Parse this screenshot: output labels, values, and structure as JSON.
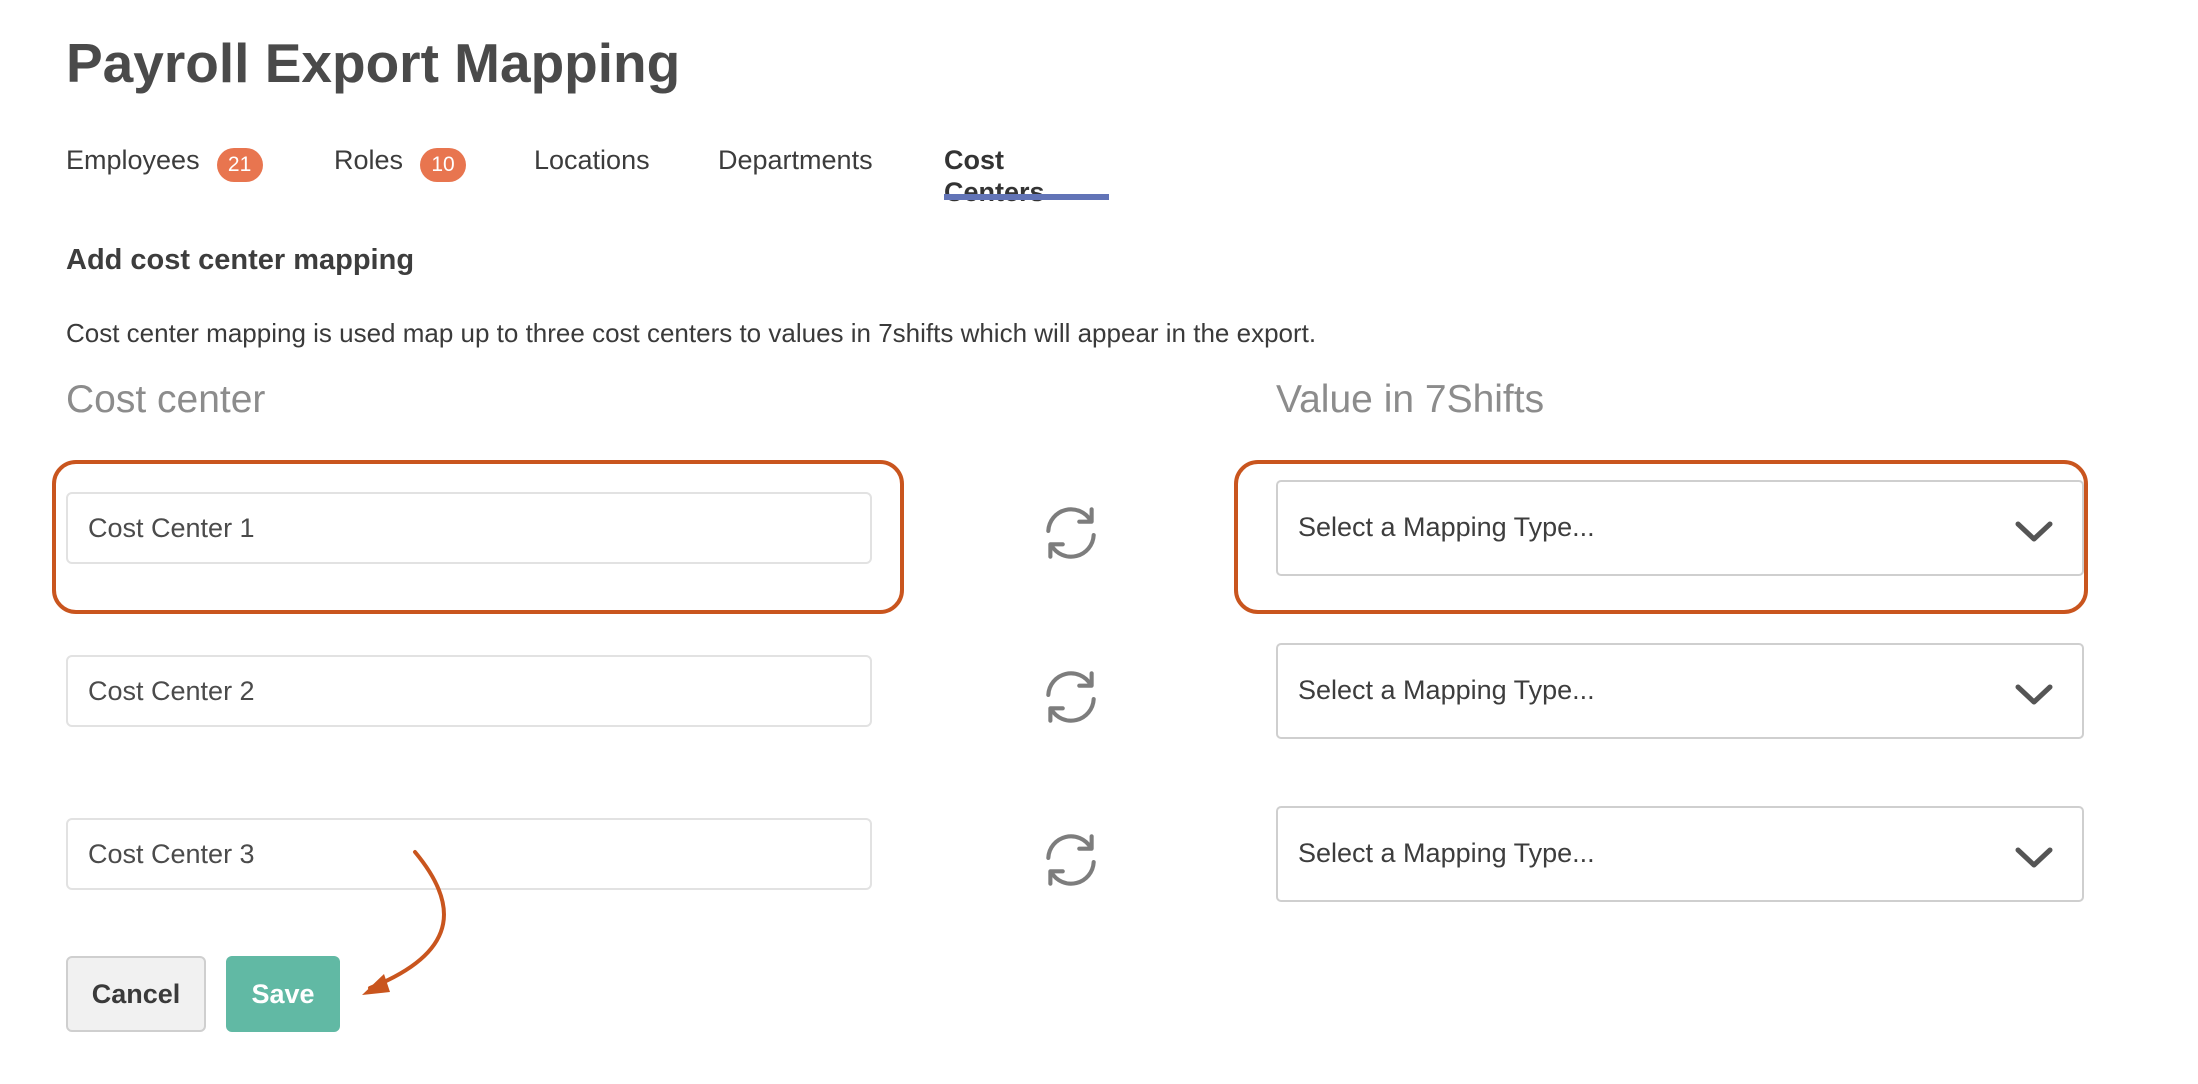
{
  "page": {
    "title": "Payroll Export Mapping"
  },
  "tabs": [
    {
      "label": "Employees",
      "badge": "21",
      "active": false
    },
    {
      "label": "Roles",
      "badge": "10",
      "active": false
    },
    {
      "label": "Locations",
      "active": false
    },
    {
      "label": "Departments",
      "active": false
    },
    {
      "label": "Cost Centers",
      "active": true
    }
  ],
  "section": {
    "heading": "Add cost center mapping",
    "description": "Cost center mapping is used map up to three cost centers to values in 7shifts which will appear in the export."
  },
  "columns": {
    "left_header": "Cost center",
    "right_header": "Value in 7Shifts"
  },
  "rows": [
    {
      "cost_center_value": "Cost Center 1",
      "mapping_select": "Select a Mapping Type..."
    },
    {
      "cost_center_value": "Cost Center 2",
      "mapping_select": "Select a Mapping Type..."
    },
    {
      "cost_center_value": "Cost Center 3",
      "mapping_select": "Select a Mapping Type..."
    }
  ],
  "actions": {
    "cancel_label": "Cancel",
    "save_label": "Save"
  },
  "colors": {
    "accent_tab_underline": "#6274b7",
    "badge": "#e8754f",
    "save_button": "#61b9a4",
    "annotation": "#c9551e"
  },
  "icons": {
    "sync": "sync-icon",
    "chevron": "chevron-down-icon",
    "annotation_arrow": "annotation-arrow"
  }
}
